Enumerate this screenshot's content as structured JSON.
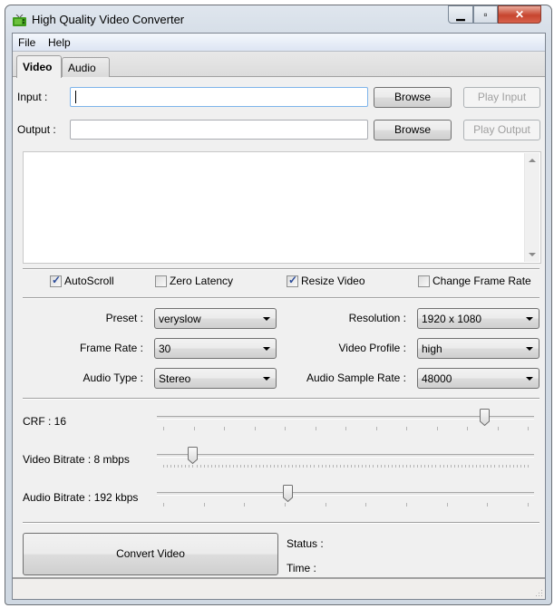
{
  "window": {
    "title": "High Quality Video Converter",
    "app_icon": "tv-icon",
    "controls": {
      "minimize": "minimize-icon",
      "maximize": "maximize-icon",
      "close": "close-icon"
    }
  },
  "menu": {
    "items": [
      {
        "label": "File"
      },
      {
        "label": "Help"
      }
    ]
  },
  "tabs": [
    {
      "label": "Video",
      "active": true
    },
    {
      "label": "Audio",
      "active": false
    }
  ],
  "io": {
    "input_label": "Input   :",
    "input_value": "",
    "output_label": "Output :",
    "output_value": "",
    "browse_input": "Browse",
    "browse_output": "Browse",
    "play_input": "Play Input",
    "play_output": "Play Output"
  },
  "log": {
    "text": ""
  },
  "options": [
    {
      "label": "AutoScroll",
      "checked": true
    },
    {
      "label": "Zero Latency",
      "checked": false
    },
    {
      "label": "Resize Video",
      "checked": true
    },
    {
      "label": "Change Frame Rate",
      "checked": false
    }
  ],
  "settings": {
    "preset": {
      "label": "Preset :",
      "value": "veryslow"
    },
    "frame_rate": {
      "label": "Frame Rate :",
      "value": "30"
    },
    "audio_type": {
      "label": "Audio Type :",
      "value": "Stereo"
    },
    "resolution": {
      "label": "Resolution :",
      "value": "1920 x 1080"
    },
    "video_profile": {
      "label": "Video Profile :",
      "value": "high"
    },
    "audio_sample_rate": {
      "label": "Audio Sample Rate :",
      "value": "48000"
    }
  },
  "sliders": [
    {
      "label": "CRF : 16",
      "fraction": 0.88,
      "ticks": 13
    },
    {
      "label": "Video Bitrate : 8 mbps",
      "fraction": 0.08,
      "ticks": 100
    },
    {
      "label": "Audio Bitrate : 192 kbps",
      "fraction": 0.34,
      "ticks": 10
    }
  ],
  "actions": {
    "convert": "Convert  Video"
  },
  "status": {
    "status_label": "Status  :",
    "status_value": "",
    "time_label": "Time    :",
    "time_value": ""
  }
}
